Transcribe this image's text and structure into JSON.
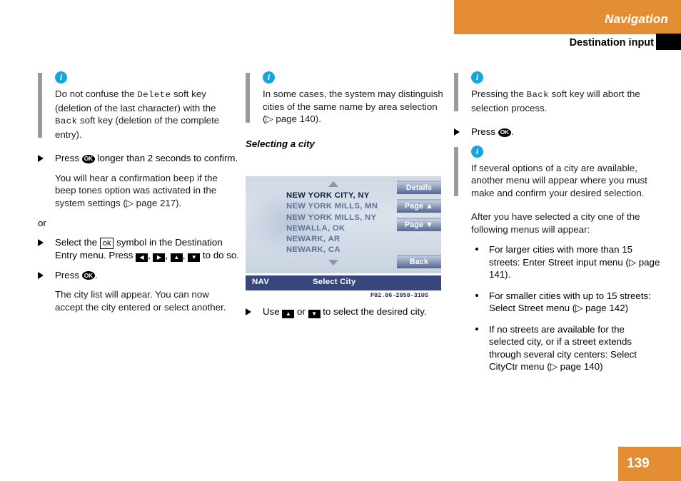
{
  "header": {
    "title": "Navigation",
    "subtitle": "Destination input",
    "accent_color": "#e48d33",
    "tab_color": "#000000"
  },
  "page_number": "139",
  "column1": {
    "note1": {
      "icon": "info-icon",
      "text_part1": "Do not confuse the ",
      "mono1": "Delete",
      "text_part2": " soft key (deletion of the last character) with the ",
      "mono2": "Back",
      "text_part3": " soft key (deletion of the complete entry)."
    },
    "step1": {
      "text_before": "Press ",
      "glyph": "OK",
      "text_after": " longer than 2 seconds to confirm."
    },
    "para1": "You will hear a confirmation beep if the beep tones option was activated in the system settings (▷ page 217).",
    "or_label": "or",
    "step2": {
      "text_before": "Select the ",
      "boxed_glyph": "ok",
      "text_middle": " symbol in the Destination Entry menu. Press ",
      "keys": [
        "◀",
        "▶",
        "▲",
        "▼"
      ],
      "text_after": " to do so."
    },
    "step3": {
      "text_before": "Press ",
      "glyph": "OK",
      "text_after": "."
    },
    "para2": "The city list will appear. You can now accept the city entered or select another."
  },
  "column2": {
    "note1": {
      "icon": "info-icon",
      "text": "In some cases, the system may distinguish cities of the same name by area selection (▷ page 140)."
    },
    "section_heading": "Selecting a city",
    "nav_screen": {
      "scroll_up_icon": "triangle-up-icon",
      "scroll_down_icon": "triangle-down-icon",
      "list": [
        {
          "label": "NEW YORK CITY, NY",
          "selected": true
        },
        {
          "label": "NEW YORK MILLS, MN",
          "selected": false
        },
        {
          "label": "NEW YORK MILLS, NY",
          "selected": false
        },
        {
          "label": "NEWALLA, OK",
          "selected": false
        },
        {
          "label": "NEWARK, AR",
          "selected": false
        },
        {
          "label": "NEWARK, CA",
          "selected": false
        }
      ],
      "softkeys": [
        {
          "label": "Details"
        },
        {
          "label": "Page ▲"
        },
        {
          "label": "Page ▼"
        },
        {
          "label": "Back"
        }
      ],
      "footer_left": "NAV",
      "footer_title": "Select City",
      "softkey_color": "#506694",
      "footer_color": "#37477c"
    },
    "figure_code": "P82.86-2858-31US",
    "step1": {
      "text_before": "Use ",
      "key_up": "▲",
      "text_middle": " or ",
      "key_down": "▼",
      "text_after": " to select the desired city."
    }
  },
  "column3": {
    "note1": {
      "icon": "info-icon",
      "text_before": "Pressing the ",
      "mono": "Back",
      "text_after": " soft key will abort the selection process."
    },
    "step1": {
      "text_before": "Press ",
      "glyph": "OK",
      "text_after": "."
    },
    "note2": {
      "icon": "info-icon",
      "text": "If several options of a city are available, another menu will appear where you must make and confirm your desired selection."
    },
    "para1": "After you have selected a city one of the following menus will appear:",
    "bullets": [
      "For larger cities with more than 15 streets: Enter Street input menu (▷ page 141).",
      "For smaller cities with up to 15 streets: Select Street menu (▷ page 142)",
      "If no streets are available for the selected city, or if a street extends through several city centers: Select CityCtr menu (▷ page 140)"
    ]
  }
}
